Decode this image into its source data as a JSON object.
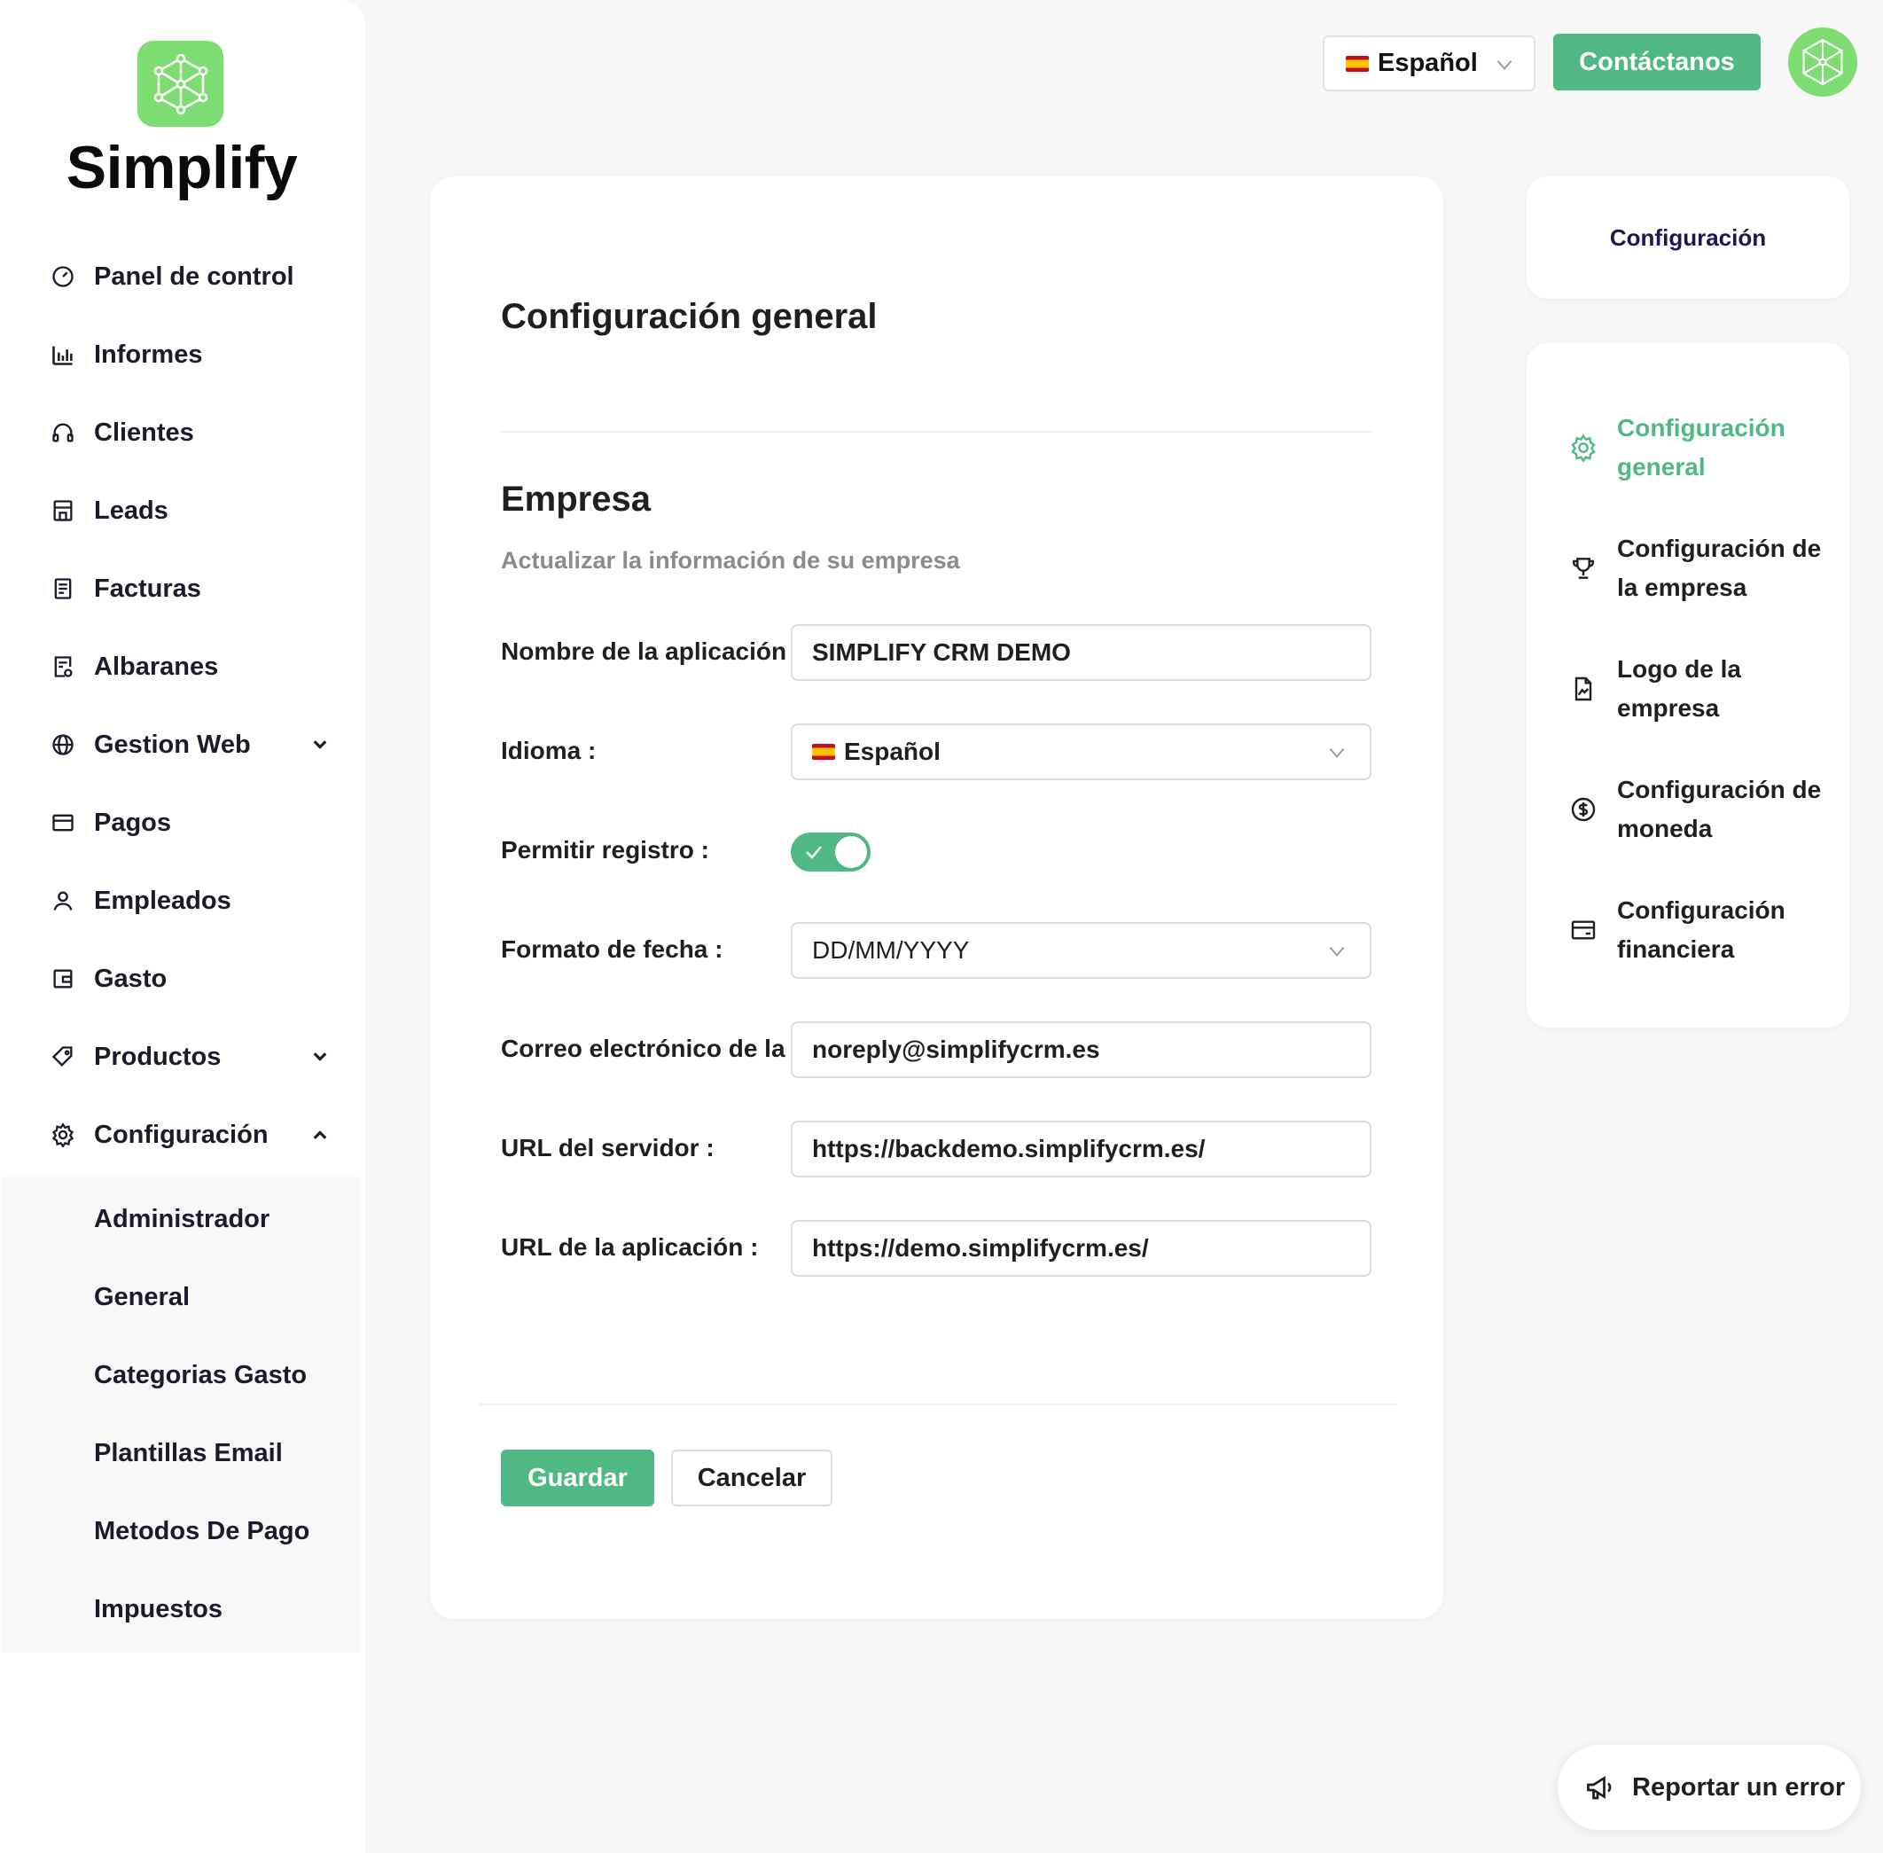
{
  "brand": {
    "name": "Simplify",
    "accent": "#4fb883",
    "logo_bg": "#7ddc72"
  },
  "topbar": {
    "language": "Español",
    "contact_label": "Contáctanos"
  },
  "sidebar": {
    "items": [
      {
        "label": "Panel de control",
        "icon": "dashboard-icon"
      },
      {
        "label": "Informes",
        "icon": "bar-chart-icon"
      },
      {
        "label": "Clientes",
        "icon": "headphones-icon"
      },
      {
        "label": "Leads",
        "icon": "store-icon"
      },
      {
        "label": "Facturas",
        "icon": "invoice-icon"
      },
      {
        "label": "Albaranes",
        "icon": "delivery-note-icon"
      },
      {
        "label": "Gestion Web",
        "icon": "globe-icon"
      },
      {
        "label": "Pagos",
        "icon": "card-icon"
      },
      {
        "label": "Empleados",
        "icon": "user-icon"
      },
      {
        "label": "Gasto",
        "icon": "wallet-icon"
      },
      {
        "label": "Productos",
        "icon": "tag-icon"
      },
      {
        "label": "Configuración",
        "icon": "gear-icon"
      }
    ],
    "submenu": [
      "Administrador",
      "General",
      "Categorias Gasto",
      "Plantillas Email",
      "Metodos De Pago",
      "Impuestos"
    ]
  },
  "main": {
    "title": "Configuración general",
    "section_title": "Empresa",
    "section_subtitle": "Actualizar la información de su empresa",
    "fields": {
      "app_name": {
        "label": "Nombre de la aplicación",
        "value": "SIMPLIFY CRM DEMO"
      },
      "language": {
        "label": "Idioma :",
        "value": "Español"
      },
      "allow_register": {
        "label": "Permitir registro :",
        "enabled": true
      },
      "date_format": {
        "label": "Formato de fecha :",
        "value": "DD/MM/YYYY"
      },
      "email": {
        "label": "Correo electrónico de la",
        "value": "noreply@simplifycrm.es"
      },
      "server_url": {
        "label": "URL del servidor :",
        "value": "https://backdemo.simplifycrm.es/"
      },
      "app_url": {
        "label": "URL de la aplicación :",
        "value": "https://demo.simplifycrm.es/"
      }
    },
    "save_label": "Guardar",
    "cancel_label": "Cancelar"
  },
  "right_panel": {
    "header": "Configuración",
    "items": [
      {
        "label": "Configuración general",
        "icon": "gear-icon",
        "active": true
      },
      {
        "label": "Configuración de la empresa",
        "icon": "trophy-icon",
        "active": false
      },
      {
        "label": "Logo de la empresa",
        "icon": "image-file-icon",
        "active": false
      },
      {
        "label": "Configuración de moneda",
        "icon": "dollar-circle-icon",
        "active": false
      },
      {
        "label": "Configuración financiera",
        "icon": "card-icon",
        "active": false
      }
    ]
  },
  "report_label": "Reportar un error"
}
